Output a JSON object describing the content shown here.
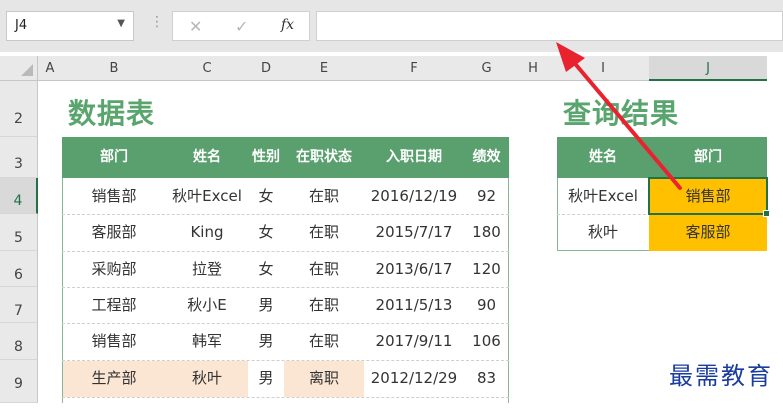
{
  "formula_bar": {
    "name_box": "J4",
    "separator": "⋮",
    "cancel_icon": "✕",
    "enter_icon": "✓",
    "fx_label": "fx",
    "formula": ""
  },
  "columns": [
    "A",
    "B",
    "C",
    "D",
    "E",
    "F",
    "G",
    "H",
    "I",
    "J"
  ],
  "rows": [
    "2",
    "3",
    "4",
    "5",
    "6",
    "7",
    "8",
    "9"
  ],
  "left_table": {
    "title": "数据表",
    "headers": [
      "部门",
      "姓名",
      "性别",
      "在职状态",
      "入职日期",
      "绩效"
    ],
    "rows": [
      [
        "销售部",
        "秋叶Excel",
        "女",
        "在职",
        "2016/12/19",
        "92"
      ],
      [
        "客服部",
        "King",
        "女",
        "在职",
        "2015/7/17",
        "180"
      ],
      [
        "采购部",
        "拉登",
        "女",
        "在职",
        "2013/6/17",
        "120"
      ],
      [
        "工程部",
        "秋小E",
        "男",
        "在职",
        "2011/5/13",
        "90"
      ],
      [
        "销售部",
        "韩军",
        "男",
        "在职",
        "2017/9/11",
        "106"
      ],
      [
        "生产部",
        "秋叶",
        "男",
        "离职",
        "2012/12/29",
        "83"
      ]
    ]
  },
  "right_table": {
    "title": "查询结果",
    "headers": [
      "姓名",
      "部门"
    ],
    "rows": [
      [
        "秋叶Excel",
        "销售部"
      ],
      [
        "秋叶",
        "客服部"
      ]
    ]
  },
  "watermark": "最需教育",
  "colors": {
    "accent": "#217346",
    "title_green": "#5aa56d",
    "header_green": "#5a9f6e",
    "highlight_yellow": "#ffc000",
    "highlight_peach": "#fbe5d3",
    "arrow_red": "#e8232f"
  }
}
